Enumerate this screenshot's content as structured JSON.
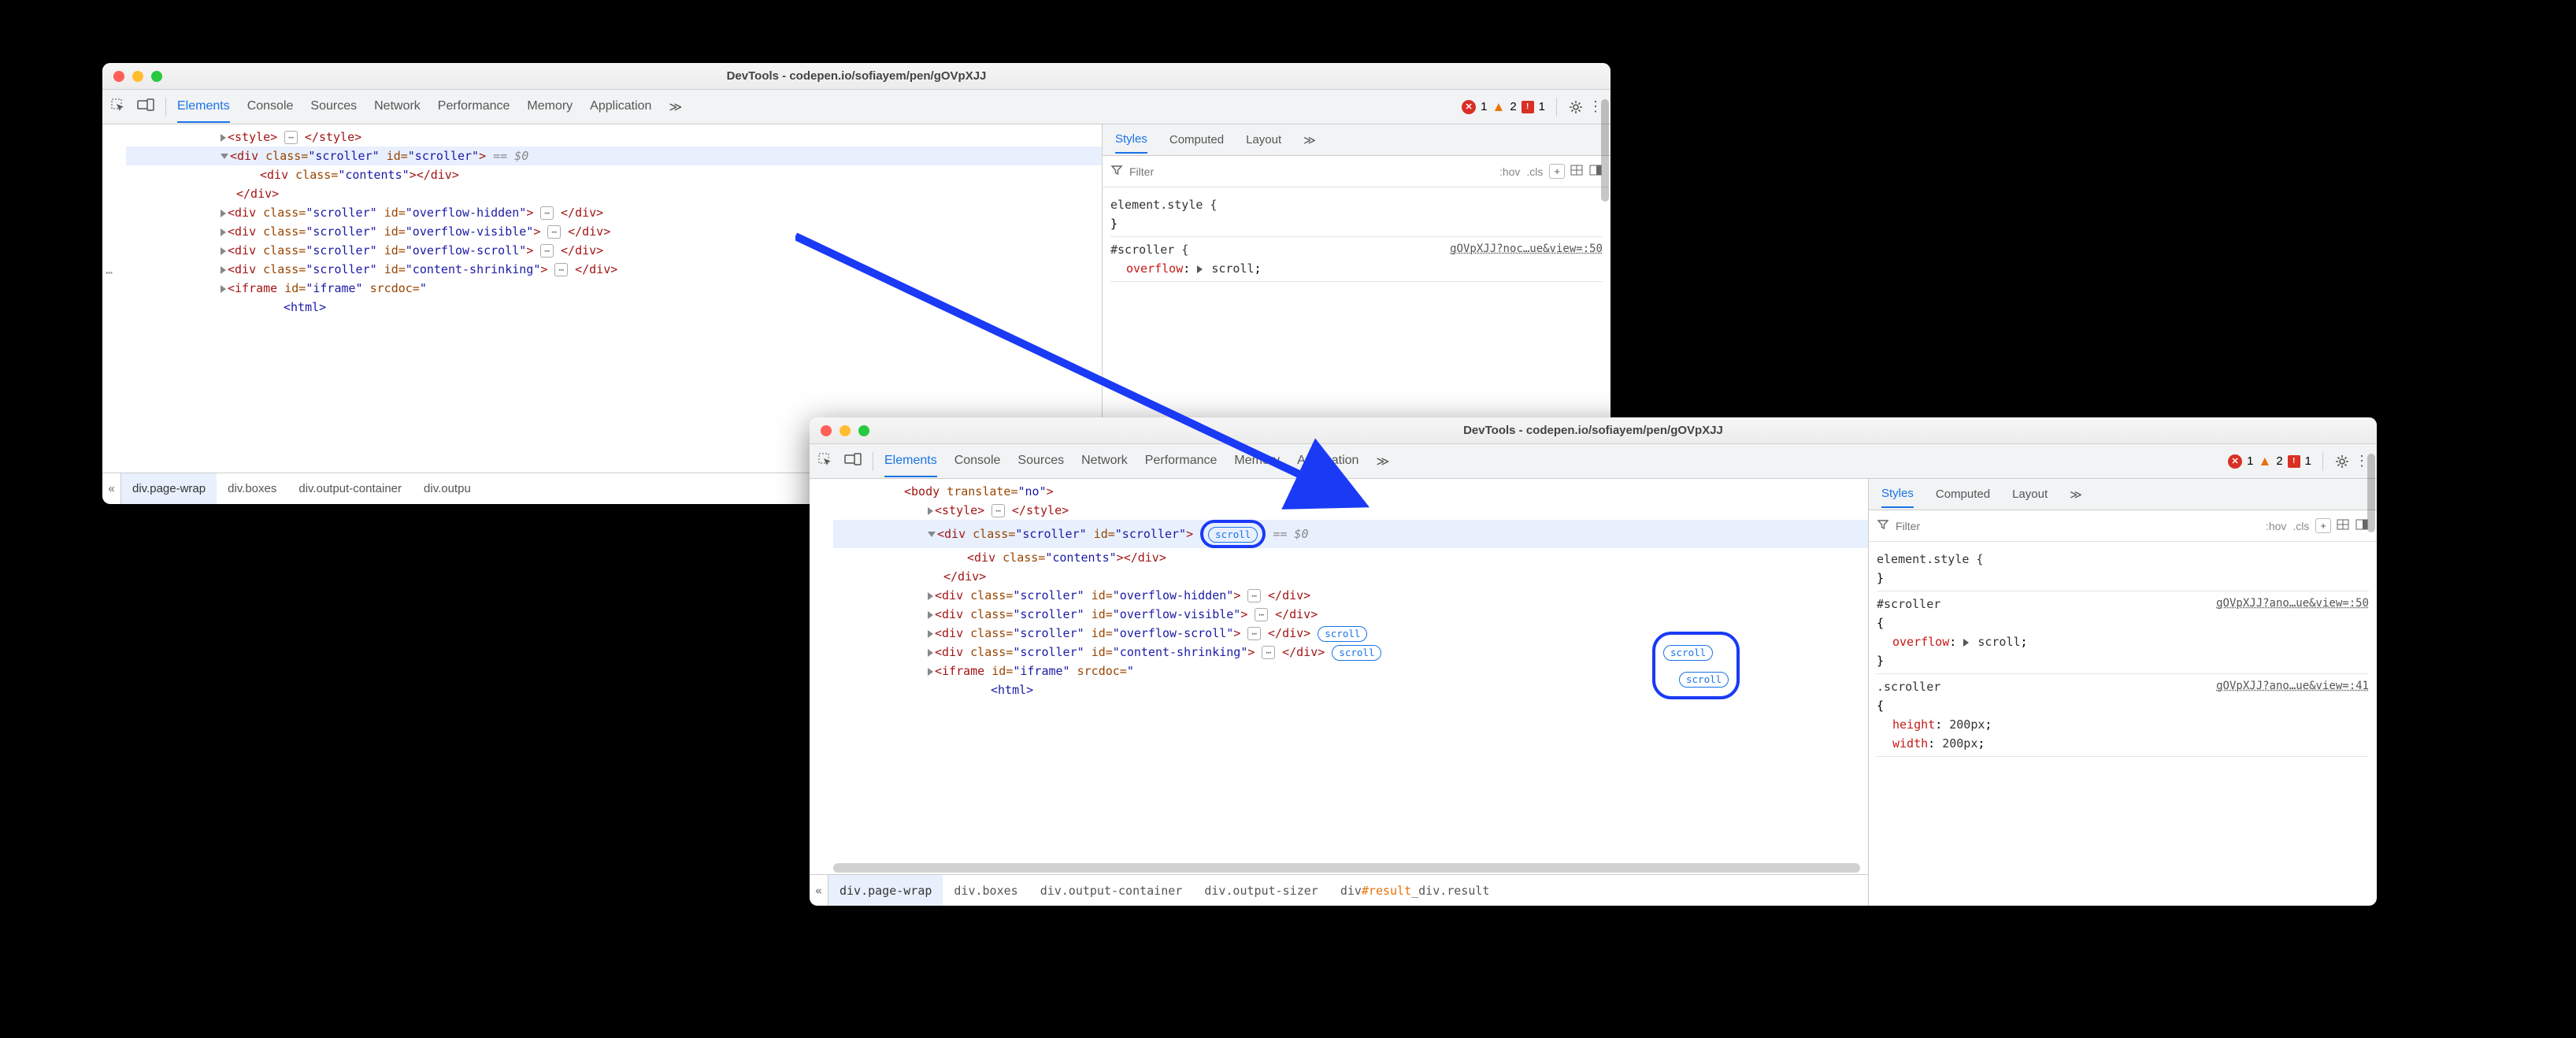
{
  "windowTitle": "DevTools - codepen.io/sofiayem/pen/gOVpXJJ",
  "mainTabs": [
    "Elements",
    "Console",
    "Sources",
    "Network",
    "Performance",
    "Memory",
    "Application"
  ],
  "overflowGlyph": "≫",
  "errors": {
    "error": "1",
    "warn": "2",
    "issue": "1"
  },
  "sideTabs": [
    "Styles",
    "Computed",
    "Layout"
  ],
  "filter": {
    "placeholder": "Filter",
    "hov": ":hov",
    "cls": ".cls"
  },
  "eq0": "== $0",
  "breadcrumbs1": [
    "div.page-wrap",
    "div.boxes",
    "div.output-container",
    "div.outpu"
  ],
  "breadcrumbs2": [
    "div.page-wrap",
    "div.boxes",
    "div.output-container",
    "div.output-sizer",
    "div#result_div.result"
  ],
  "scrollBadge": "scroll",
  "tree": {
    "style_open": "<style>",
    "style_close": "</style>",
    "div_open": "<div",
    "div_close": ">",
    "div_end": "</div>",
    "class_attr": "class=",
    "id_attr": "id=",
    "scroller_v": "\"scroller\"",
    "contents_v": "\"contents\"",
    "ids": {
      "scroller": "\"scroller\"",
      "oh": "\"overflow-hidden\"",
      "ov": "\"overflow-visible\"",
      "os": "\"overflow-scroll\"",
      "cs": "\"content-shrinking\"",
      "iframe": "\"iframe\""
    },
    "iframe_open": "<iframe",
    "srcdoc": "srcdoc=",
    "html": "<html>",
    "body_open": "<body",
    "translate": "translate=",
    "no": "\"no\""
  },
  "styles1": {
    "estyle": "element.style {",
    "brace": "}",
    "sel1": "#scroller {",
    "src1": "gOVpXJJ?noc…ue&view=:50",
    "p1n": "overflow",
    "p1v": "scroll"
  },
  "styles2": {
    "estyle": "element.style {",
    "brace": "}",
    "sel1": "#scroller",
    "src1": "gOVpXJJ?ano…ue&view=:50",
    "p1n": "overflow",
    "p1v": "scroll",
    "sel2": ".scroller",
    "src2": "gOVpXJJ?ano…ue&view=:41",
    "p2n": "height",
    "p2v": "200px",
    "p3n": "width",
    "p3v": "200px"
  }
}
